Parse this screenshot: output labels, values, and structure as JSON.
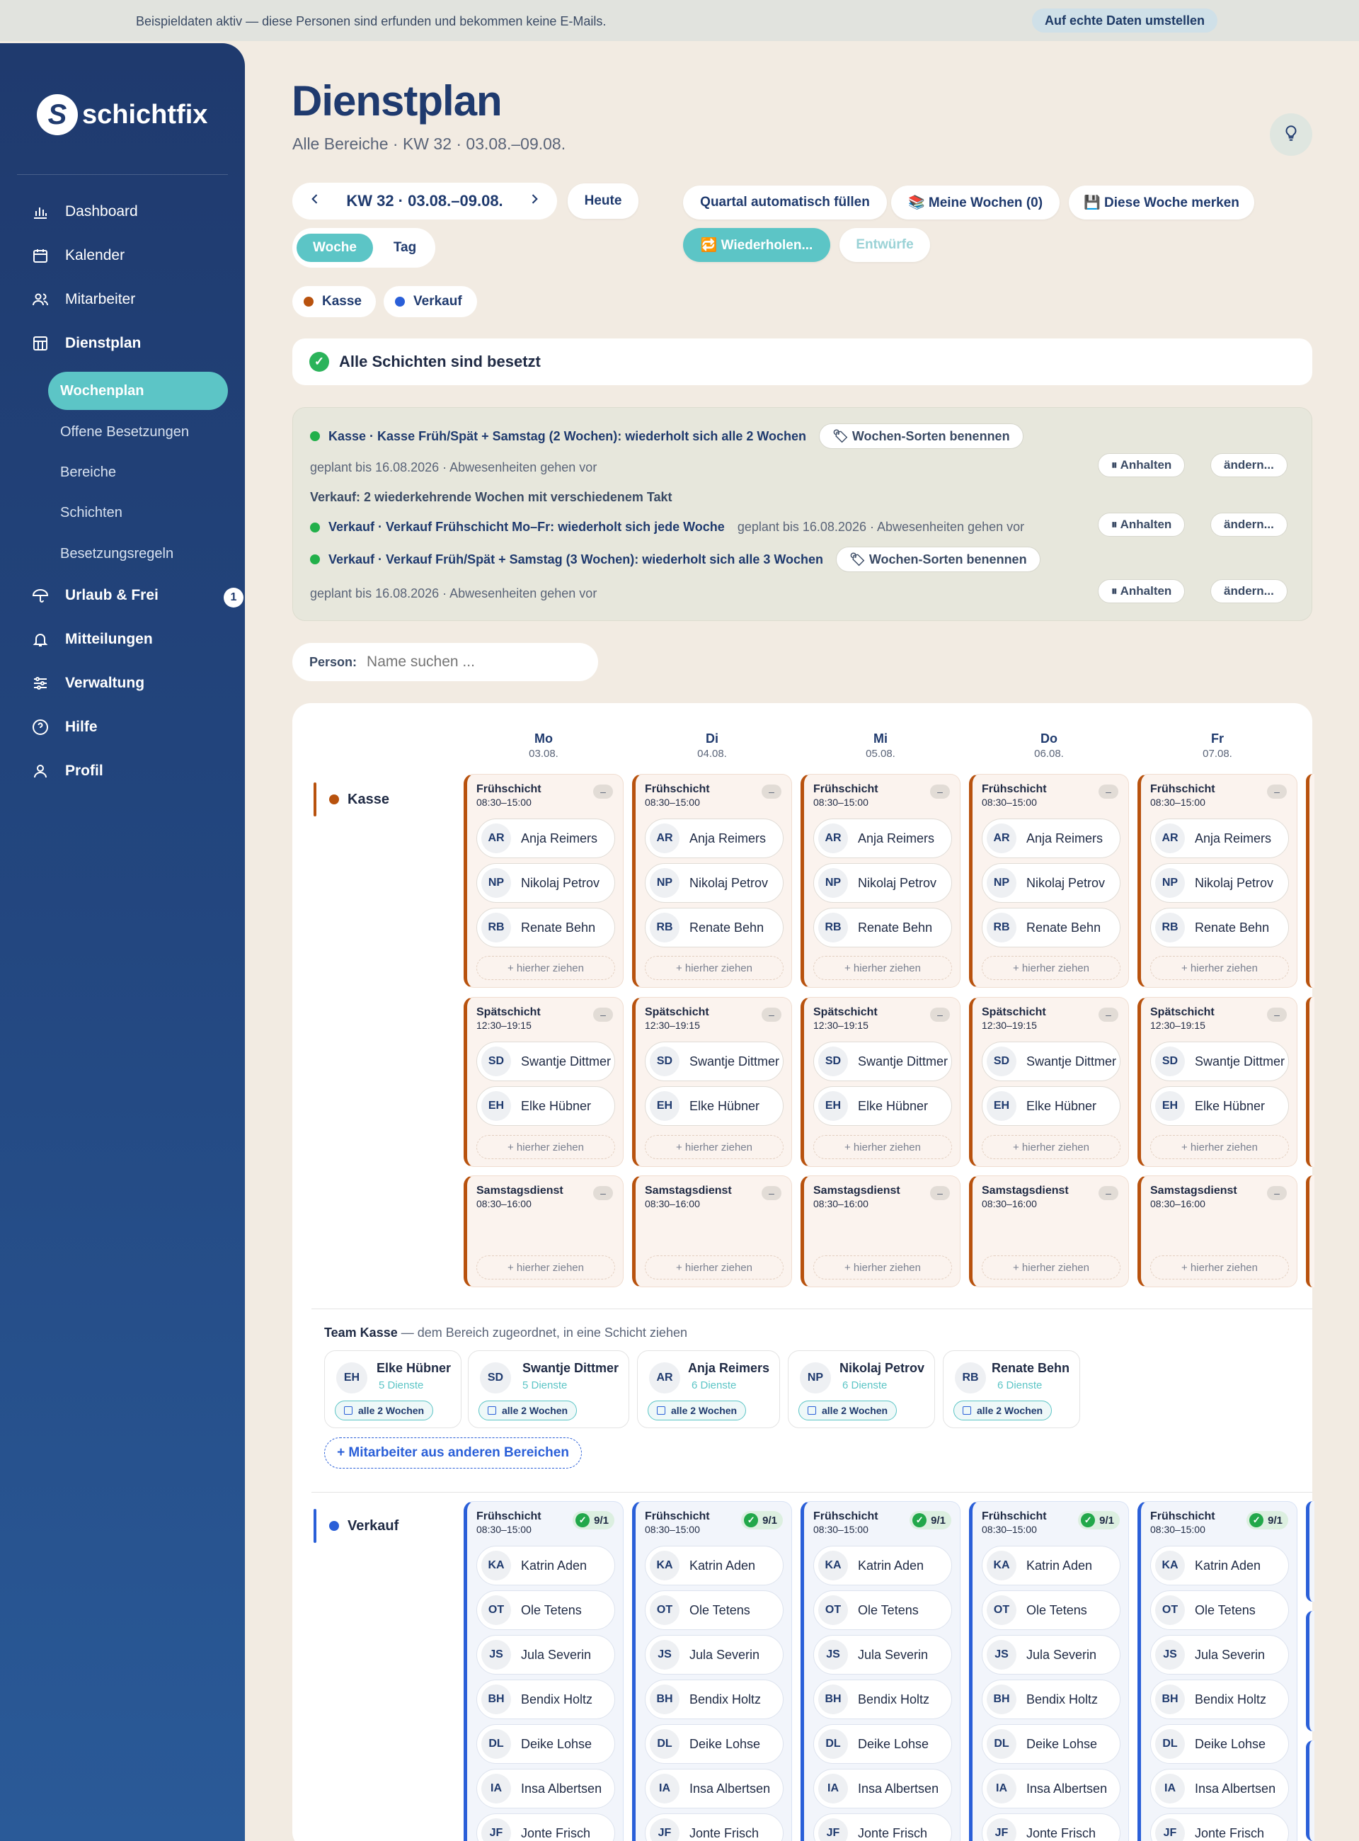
{
  "banner": {
    "text": "Beispieldaten aktiv — diese Personen sind erfunden und bekommen keine E-Mails.",
    "button": "Auf echte Daten umstellen"
  },
  "app": {
    "brand": "schichtfix",
    "logo_letter": "S"
  },
  "nav": {
    "items": [
      {
        "label": "Dashboard",
        "icon": "chart-icon"
      },
      {
        "label": "Kalender",
        "icon": "calendar-icon"
      },
      {
        "label": "Mitarbeiter",
        "icon": "users-icon"
      },
      {
        "label": "Dienstplan",
        "icon": "grid-icon"
      }
    ],
    "sub": [
      "Wochenplan",
      "Offene Besetzungen",
      "Bereiche",
      "Schichten",
      "Besetzungsregeln"
    ],
    "items2": [
      {
        "label": "Urlaub & Frei",
        "icon": "umbrella-icon",
        "badge": "1"
      },
      {
        "label": "Mitteilungen",
        "icon": "bell-icon"
      },
      {
        "label": "Verwaltung",
        "icon": "sliders-icon"
      },
      {
        "label": "Hilfe",
        "icon": "help-icon"
      },
      {
        "label": "Profil",
        "icon": "user-icon"
      }
    ]
  },
  "header": {
    "title": "Dienstplan",
    "subtitle": "Alle Bereiche · KW 32 · 03.08.–09.08."
  },
  "toolbar": {
    "week": "KW 32 · 03.08.–09.08.",
    "today": "Heute",
    "fill": "Quartal automatisch füllen",
    "my_weeks": "📚 Meine Wochen (0)",
    "remember": "💾 Diese Woche merken",
    "repeat": "🔁 Wiederholen...",
    "drafts": "Entwürfe",
    "view_week": "Woche",
    "view_day": "Tag"
  },
  "legend": [
    {
      "label": "Kasse",
      "color": "#b8520e"
    },
    {
      "label": "Verkauf",
      "color": "#2a5fd8"
    }
  ],
  "status": {
    "text": "Alle Schichten sind besetzt"
  },
  "series": {
    "s1_title": "Kasse · Kasse Früh/Spät + Samstag (2 Wochen): wiederholt sich alle 2 Wochen",
    "s1_meta": "geplant bis 16.08.2026 · Abwesenheiten gehen vor",
    "name_btn": "🏷 Wochen-Sorten benennen",
    "pause": "⏸ Anhalten",
    "change": "ändern...",
    "verk_head": "Verkauf: 2 wiederkehrende Wochen mit verschiedenem Takt",
    "s2_title": "Verkauf · Verkauf Frühschicht Mo–Fr: wiederholt sich jede Woche",
    "s2_meta": "geplant bis 16.08.2026 · Abwesenheiten gehen vor",
    "s3_title": "Verkauf · Verkauf Früh/Spät + Samstag (3 Wochen): wiederholt sich alle 3 Wochen",
    "s3_meta": "geplant bis 16.08.2026 · Abwesenheiten gehen vor"
  },
  "search": {
    "label": "Person:",
    "placeholder": "Name suchen ..."
  },
  "days": [
    {
      "d": "Mo",
      "date": "03.08."
    },
    {
      "d": "Di",
      "date": "04.08."
    },
    {
      "d": "Mi",
      "date": "05.08."
    },
    {
      "d": "Do",
      "date": "06.08."
    },
    {
      "d": "Fr",
      "date": "07.08."
    }
  ],
  "areas": {
    "kasse": "Kasse",
    "verkauf": "Verkauf"
  },
  "kasse_shifts": [
    {
      "name": "Frühschicht",
      "time": "08:30–15:00",
      "people": [
        {
          "ini": "AR",
          "name": "Anja Reimers"
        },
        {
          "ini": "NP",
          "name": "Nikolaj Petrov"
        },
        {
          "ini": "RB",
          "name": "Renate Behn"
        }
      ]
    },
    {
      "name": "Spätschicht",
      "time": "12:30–19:15",
      "people": [
        {
          "ini": "SD",
          "name": "Swantje Dittmer"
        },
        {
          "ini": "EH",
          "name": "Elke Hübner"
        }
      ]
    },
    {
      "name": "Samstagsdienst",
      "time": "08:30–16:00",
      "people": []
    }
  ],
  "verkauf_shifts": [
    {
      "name": "Frühschicht",
      "time": "08:30–15:00",
      "badge": "9/1",
      "people": [
        {
          "ini": "KA",
          "name": "Katrin Aden"
        },
        {
          "ini": "OT",
          "name": "Ole Tetens"
        },
        {
          "ini": "JS",
          "name": "Jula Severin"
        },
        {
          "ini": "BH",
          "name": "Bendix Holtz"
        },
        {
          "ini": "DL",
          "name": "Deike Lohse"
        },
        {
          "ini": "IA",
          "name": "Insa Albertsen"
        },
        {
          "ini": "JF",
          "name": "Jonte Frisch"
        }
      ]
    }
  ],
  "drop_label": "+ hierher ziehen",
  "minus": "–",
  "team": {
    "title": "Team Kasse",
    "sub": " — dem Bereich zugeordnet, in eine Schicht ziehen",
    "members": [
      {
        "ini": "EH",
        "name": "Elke Hübner",
        "dienste": "5 Dienste",
        "tag": "alle 2 Wochen"
      },
      {
        "ini": "SD",
        "name": "Swantje Dittmer",
        "dienste": "5 Dienste",
        "tag": "alle 2 Wochen"
      },
      {
        "ini": "AR",
        "name": "Anja Reimers",
        "dienste": "6 Dienste",
        "tag": "alle 2 Wochen"
      },
      {
        "ini": "NP",
        "name": "Nikolaj Petrov",
        "dienste": "6 Dienste",
        "tag": "alle 2 Wochen"
      },
      {
        "ini": "RB",
        "name": "Renate Behn",
        "dienste": "6 Dienste",
        "tag": "alle 2 Wochen"
      }
    ],
    "add": "+ Mitarbeiter aus anderen Bereichen"
  }
}
